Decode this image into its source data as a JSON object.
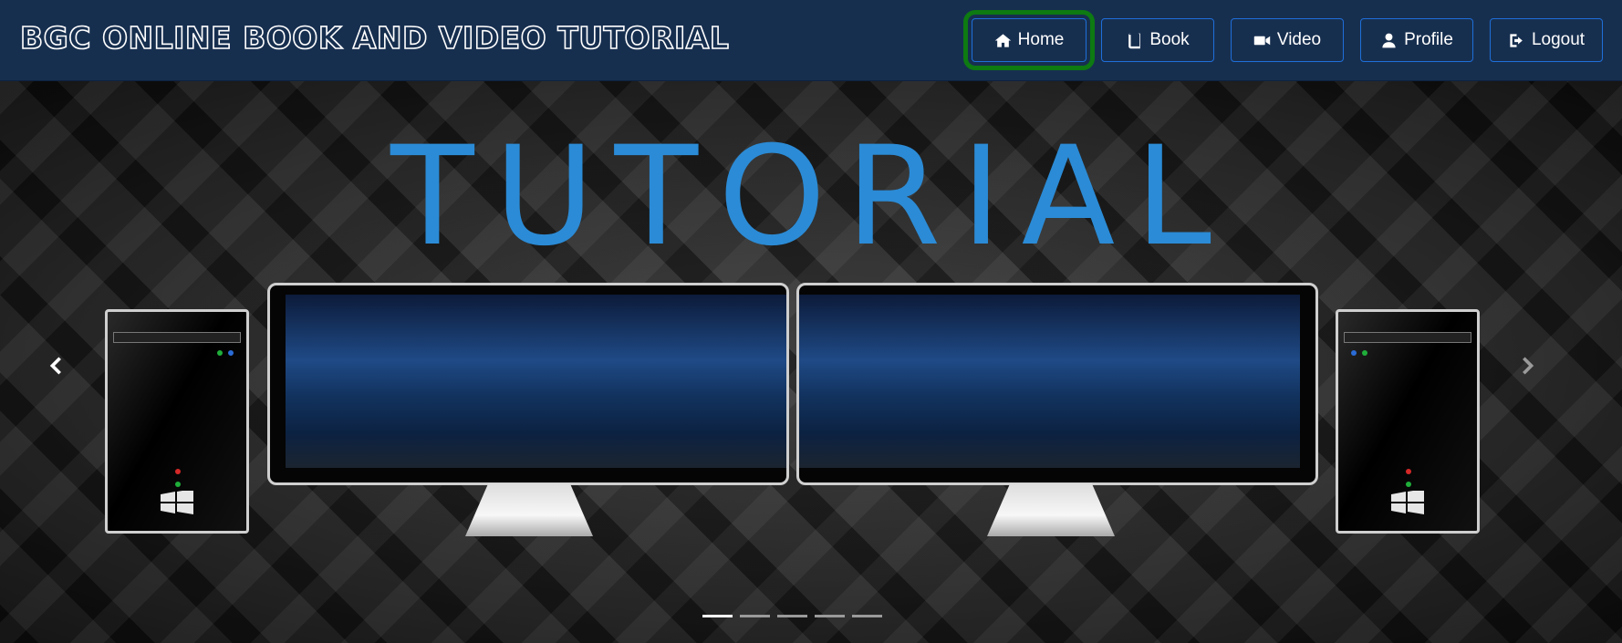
{
  "header": {
    "brand": "BGC ONLINE BOOK AND VIDEO TUTORIAL",
    "nav": [
      {
        "label": "Home",
        "icon": "home-icon"
      },
      {
        "label": "Book",
        "icon": "book-icon"
      },
      {
        "label": "Video",
        "icon": "video-camera-icon"
      },
      {
        "label": "Profile",
        "icon": "user-icon"
      },
      {
        "label": "Logout",
        "icon": "logout-icon"
      }
    ],
    "active_item": "Home"
  },
  "hero": {
    "title": "TUTORIAL",
    "slide_count": 5,
    "active_slide": 1
  },
  "colors": {
    "navbar_bg": "#172f4f",
    "button_border": "#1e6fd9",
    "active_outline": "#0d7a12",
    "title_blue": "#2b8bd6"
  }
}
